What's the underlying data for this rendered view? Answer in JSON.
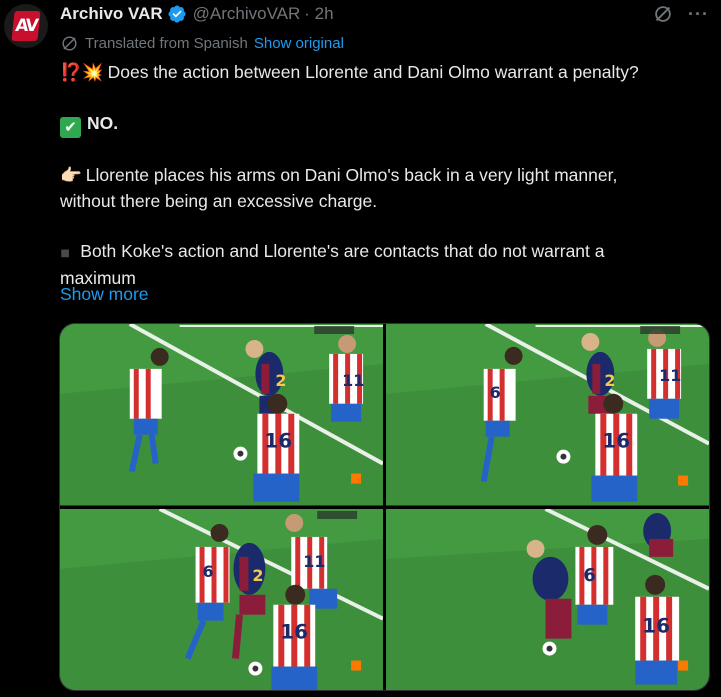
{
  "author": {
    "name": "Archivo VAR",
    "handle": "@ArchivoVAR",
    "time": "· 2h",
    "avatar_text": "AV"
  },
  "translation": {
    "label": "Translated from Spanish",
    "show_original": "Show original"
  },
  "tweet": {
    "line1_emoji": "⁉️💥",
    "line1": "Does the action between Llorente and Dani Olmo warrant a penalty?",
    "line2_emoji": "✔",
    "line2": "NO.",
    "line3_emoji": "👉🏻",
    "line3a": "Llorente places his arms on Dani Olmo's back in a very light manner,",
    "line3b": "without there being an excessive charge.",
    "line4_emoji": "◾",
    "line4a": "Both Koke's action and Llorente's are contacts that do not warrant a",
    "line4b": "maximum",
    "show_more": "Show more"
  },
  "media": {
    "count": 4,
    "photos": [
      {
        "label": "photo-1",
        "shirt_numbers": [
          "16",
          "11",
          "2"
        ]
      },
      {
        "label": "photo-2",
        "shirt_numbers": [
          "16",
          "11",
          "6",
          "2"
        ]
      },
      {
        "label": "photo-3",
        "shirt_numbers": [
          "16",
          "11",
          "6",
          "2"
        ]
      },
      {
        "label": "photo-4",
        "shirt_numbers": [
          "16",
          "6"
        ]
      }
    ]
  },
  "icons": {
    "verified": "verified-badge-icon",
    "grok": "grok-icon",
    "more": "more-icon",
    "translate": "globe-icon"
  },
  "colors": {
    "background": "#000000",
    "text": "#e7e9ea",
    "muted": "#71767b",
    "link": "#1d9bf0",
    "verified": "#1d9bf0",
    "pitch": "#3b8a3a",
    "atleti_red": "#d32f2f",
    "barca_blue": "#1b2a6b",
    "barca_red": "#8b1d3a"
  }
}
